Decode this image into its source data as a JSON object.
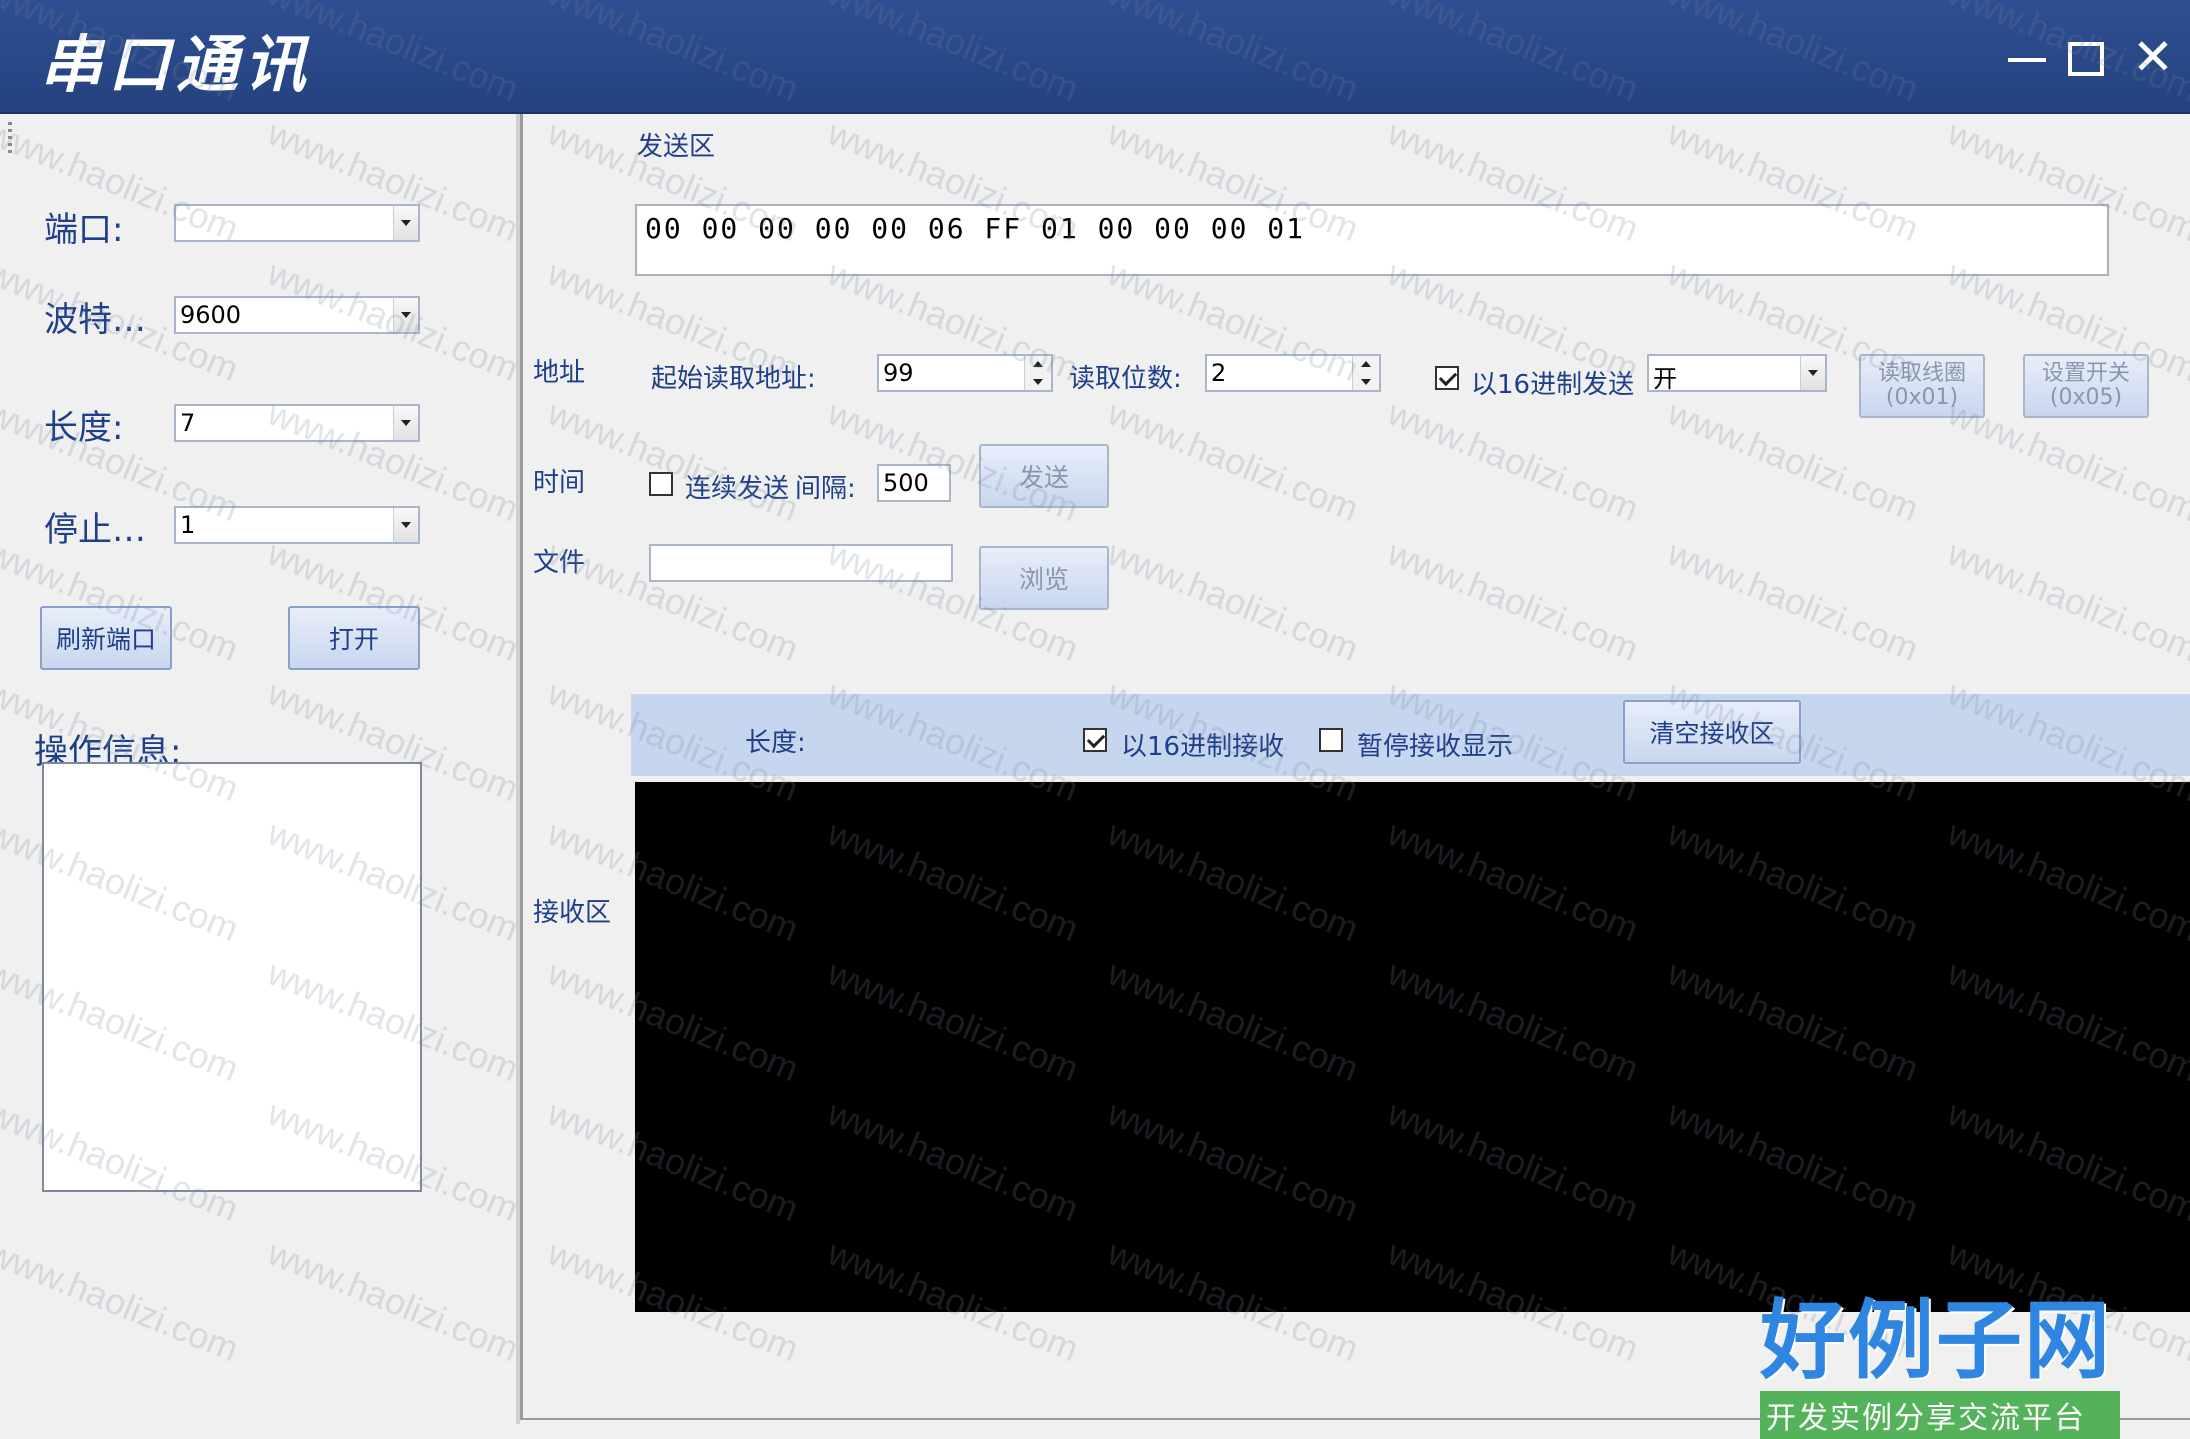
{
  "window": {
    "title": "串口通讯",
    "minimize": "—",
    "close": "✕"
  },
  "left": {
    "port_label": "端口:",
    "port_value": "",
    "baud_label": "波特…",
    "baud_value": "9600",
    "length_label": "长度:",
    "length_value": "7",
    "stop_label": "停止…",
    "stop_value": "1",
    "refresh_button": "刷新端口",
    "open_button": "打开",
    "info_label": "操作信息:"
  },
  "send": {
    "area_label": "发送区",
    "data": "00 00 00 00 00 06 FF 01 00 00 00 01",
    "address_label": "地址",
    "start_addr_label": "起始读取地址:",
    "start_addr_value": "99",
    "read_bits_label": "读取位数:",
    "read_bits_value": "2",
    "hex_send_label": "以16进制发送",
    "hex_send_checked": true,
    "switch_value": "开",
    "read_coil_button_line1": "读取线圈",
    "read_coil_button_line2": "(0x01)",
    "set_switch_button_line1": "设置开关",
    "set_switch_button_line2": "(0x05)",
    "time_label": "时间",
    "continuous_label": "连续发送",
    "continuous_checked": false,
    "interval_label": "间隔:",
    "interval_value": "500",
    "send_button": "发送",
    "file_label": "文件",
    "file_value": "",
    "browse_button": "浏览"
  },
  "receive": {
    "area_label": "接收区",
    "length_label": "长度:",
    "hex_recv_label": "以16进制接收",
    "hex_recv_checked": true,
    "pause_label": "暂停接收显示",
    "pause_checked": false,
    "clear_button": "清空接收区"
  },
  "watermark": {
    "text": "www.haolizi.com",
    "logo_main": "好例子网",
    "logo_sub": "开发实例分享交流平台"
  }
}
